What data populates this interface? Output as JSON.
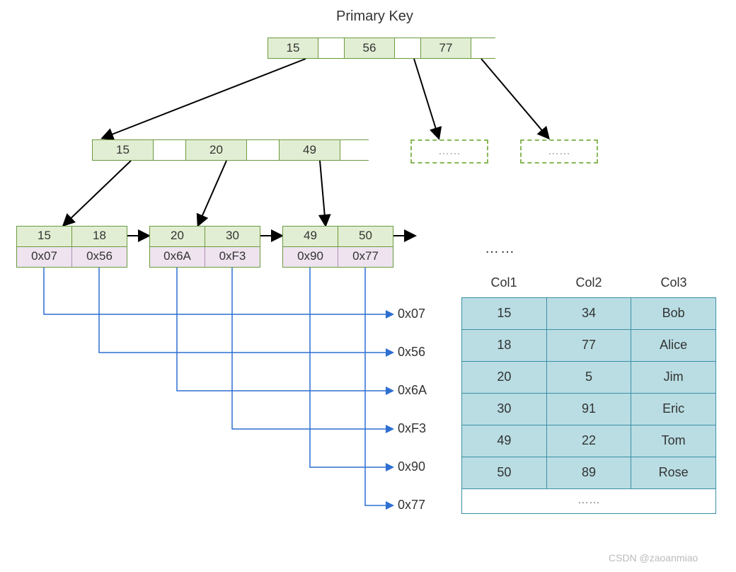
{
  "title": "Primary Key",
  "root": {
    "keys": [
      "15",
      "56",
      "77"
    ]
  },
  "internal": {
    "keys": [
      "15",
      "20",
      "49"
    ]
  },
  "leaves": [
    {
      "keys": [
        "15",
        "18"
      ],
      "ptrs": [
        "0x07",
        "0x56"
      ]
    },
    {
      "keys": [
        "20",
        "30"
      ],
      "ptrs": [
        "0x6A",
        "0xF3"
      ]
    },
    {
      "keys": [
        "49",
        "50"
      ],
      "ptrs": [
        "0x90",
        "0x77"
      ]
    }
  ],
  "ghost": "……",
  "addresses": [
    "0x07",
    "0x56",
    "0x6A",
    "0xF3",
    "0x90",
    "0x77"
  ],
  "ellipsis": "……",
  "table": {
    "headers": [
      "Col1",
      "Col2",
      "Col3"
    ],
    "rows": [
      {
        "c1": "15",
        "c2": "34",
        "c3": "Bob"
      },
      {
        "c1": "18",
        "c2": "77",
        "c3": "Alice"
      },
      {
        "c1": "20",
        "c2": "5",
        "c3": "Jim"
      },
      {
        "c1": "30",
        "c2": "91",
        "c3": "Eric"
      },
      {
        "c1": "49",
        "c2": "22",
        "c3": "Tom"
      },
      {
        "c1": "50",
        "c2": "89",
        "c3": "Rose"
      }
    ],
    "tail": "……"
  },
  "watermark": "CSDN @zaoanmiao"
}
